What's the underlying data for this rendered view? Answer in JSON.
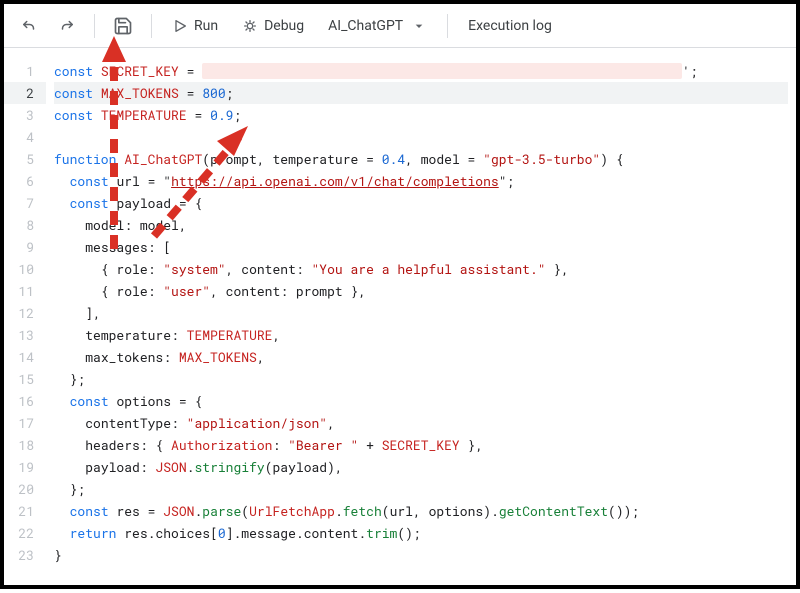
{
  "toolbar": {
    "undo": "undo",
    "redo": "redo",
    "save": "save",
    "run": "Run",
    "debug": "Debug",
    "function_select": "AI_ChatGPT",
    "exec_log": "Execution log"
  },
  "editor": {
    "line_count": 23,
    "current_line": 2,
    "constants": {
      "secret_key_name": "SECRET_KEY",
      "max_tokens_name": "MAX_TOKENS",
      "max_tokens_value": "800",
      "temperature_name": "TEMPERATURE",
      "temperature_value": "0.9"
    },
    "fn": {
      "name": "AI_ChatGPT",
      "param1": "prompt",
      "param2": "temperature",
      "param2_default": "0.4",
      "param3": "model",
      "param3_default": "\"gpt-3.5-turbo\"",
      "url_var": "url",
      "url_value": "https://api.openai.com/v1/chat/completions",
      "payload_var": "payload",
      "model_prop": "model",
      "model_val": "model",
      "messages_prop": "messages",
      "role_prop": "role",
      "system_role": "\"system\"",
      "system_content": "\"You are a helpful assistant.\"",
      "user_role": "\"user\"",
      "content_prop": "content",
      "user_content": "prompt",
      "temperature_prop": "temperature",
      "temperature_ref": "TEMPERATURE",
      "max_tokens_prop": "max_tokens",
      "max_tokens_ref": "MAX_TOKENS",
      "options_var": "options",
      "ctype_prop": "contentType",
      "ctype_val": "\"application/json\"",
      "headers_prop": "headers",
      "auth_prop": "Authorization",
      "bearer": "\"Bearer \"",
      "secret_ref": "SECRET_KEY",
      "payload_prop": "payload",
      "json_cls": "JSON",
      "stringify": "stringify",
      "res_var": "res",
      "parse": "parse",
      "urlfetch": "UrlFetchApp",
      "fetch": "fetch",
      "gct": "getContentText",
      "choices": "choices",
      "idx": "0",
      "message": "message",
      "content": "content",
      "trim": "trim"
    }
  }
}
